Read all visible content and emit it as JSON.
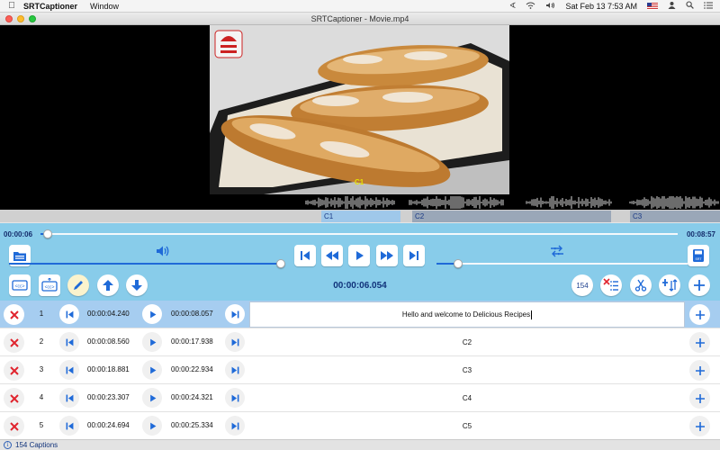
{
  "menubar": {
    "app_name": "SRTCaptioner",
    "menus": [
      "Window"
    ],
    "clock": "Sat Feb 13  7:53 AM"
  },
  "window": {
    "title": "SRTCaptioner - Movie.mp4"
  },
  "video": {
    "caption_label": "C1"
  },
  "segments": [
    "C1",
    "C2",
    "C3"
  ],
  "playback": {
    "current_time": "00:00:06",
    "total_time": "00:08:57",
    "position_time": "00:00:06.054",
    "seek_fraction": 0.011,
    "volume_fraction": 1.0,
    "speed_fraction": 0.08
  },
  "caption_count_badge": "154",
  "captions": [
    {
      "num": "1",
      "start": "00:00:04.240",
      "end": "00:00:08.057",
      "text": "Hello and welcome to Delicious Recipes",
      "selected": true
    },
    {
      "num": "2",
      "start": "00:00:08.560",
      "end": "00:00:17.938",
      "text": "C2",
      "selected": false
    },
    {
      "num": "3",
      "start": "00:00:18.881",
      "end": "00:00:22.934",
      "text": "C3",
      "selected": false
    },
    {
      "num": "4",
      "start": "00:00:23.307",
      "end": "00:00:24.321",
      "text": "C4",
      "selected": false
    },
    {
      "num": "5",
      "start": "00:00:24.694",
      "end": "00:00:25.334",
      "text": "C5",
      "selected": false
    }
  ],
  "status": {
    "caption_count": "154 Captions"
  },
  "colors": {
    "panel": "#88ccea",
    "accent": "#1f6ad8",
    "delete": "#e0242e",
    "selected_row": "#a6cdf0"
  }
}
